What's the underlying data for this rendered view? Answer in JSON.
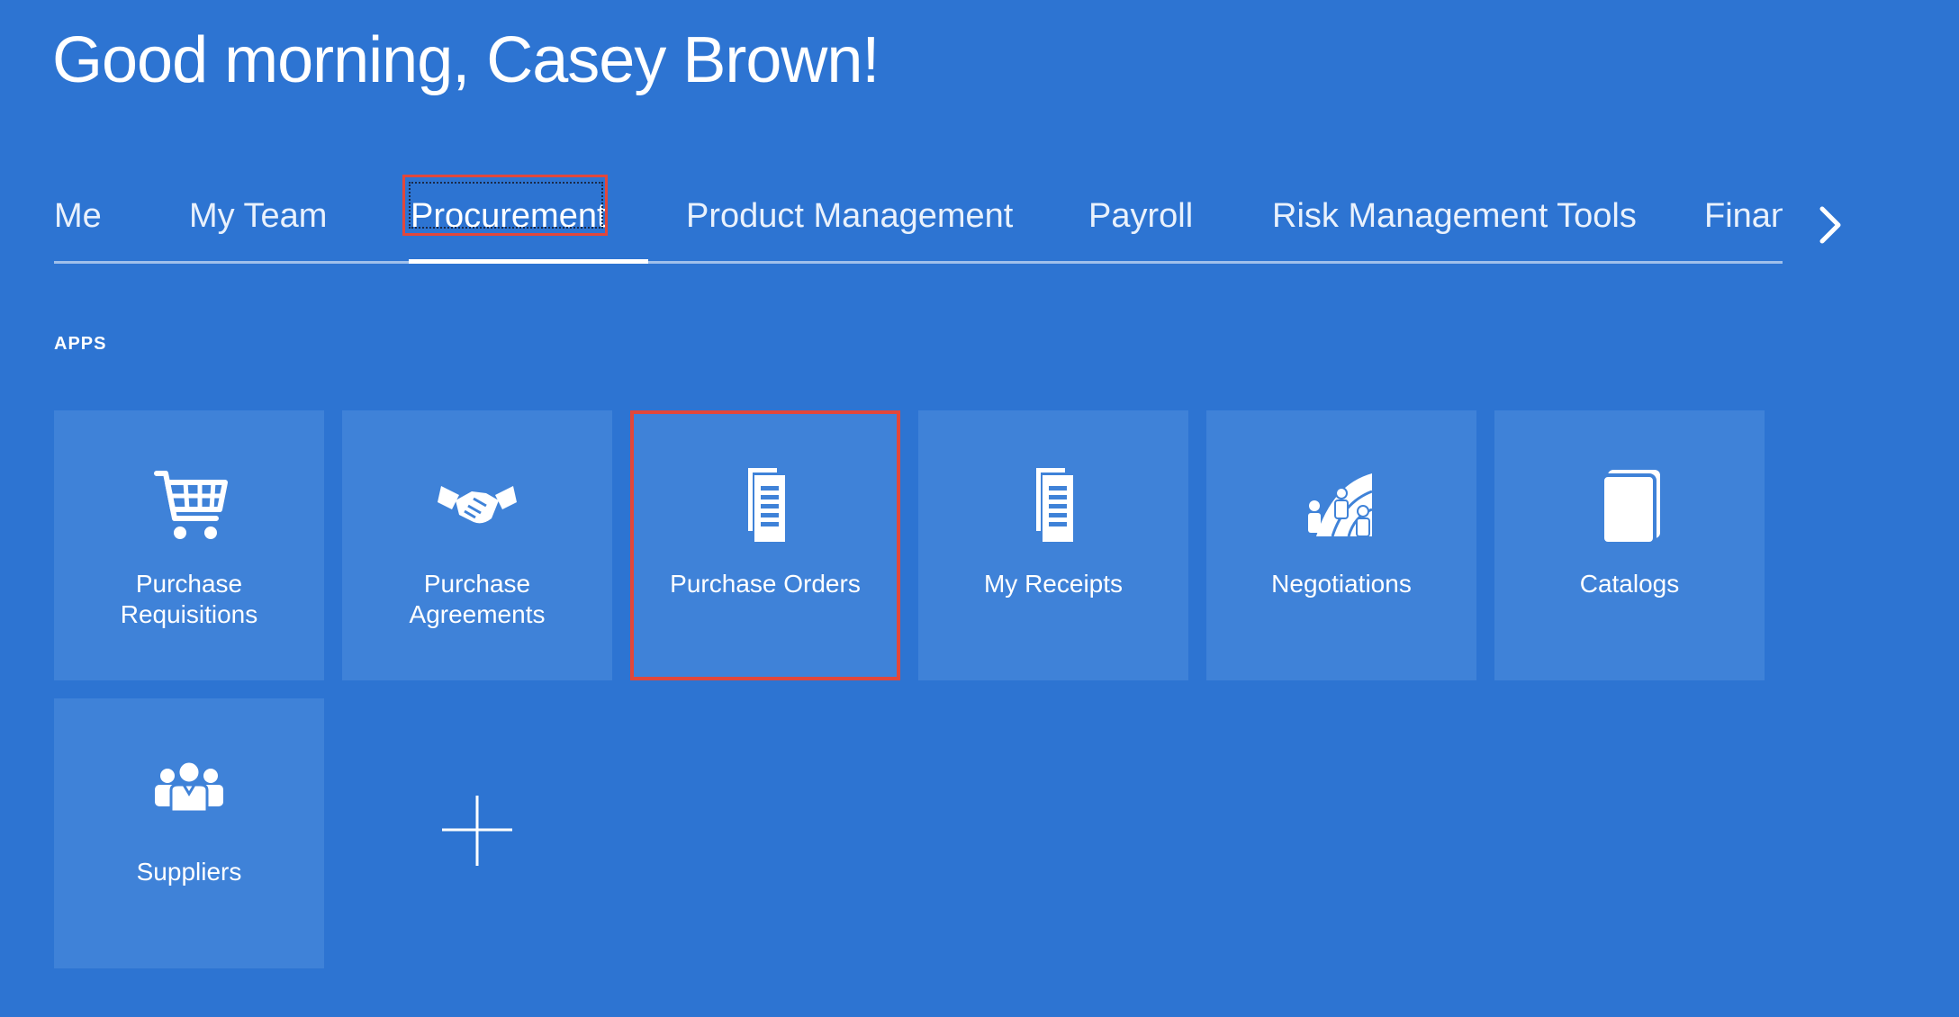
{
  "greeting": "Good morning, Casey Brown!",
  "tabs": [
    {
      "label": "Me"
    },
    {
      "label": "My Team"
    },
    {
      "label": "Procurement",
      "active": true
    },
    {
      "label": "Product Management"
    },
    {
      "label": "Payroll"
    },
    {
      "label": "Risk Management Tools"
    },
    {
      "label": "Finan"
    }
  ],
  "section": {
    "label": "APPS"
  },
  "apps": [
    {
      "label_line1": "Purchase",
      "label_line2": "Requisitions",
      "icon": "shopping-cart-icon"
    },
    {
      "label_line1": "Purchase",
      "label_line2": "Agreements",
      "icon": "handshake-icon"
    },
    {
      "label_line1": "Purchase Orders",
      "label_line2": "",
      "icon": "document-icon",
      "highlighted": true
    },
    {
      "label_line1": "My Receipts",
      "label_line2": "",
      "icon": "document-icon"
    },
    {
      "label_line1": "Negotiations",
      "label_line2": "",
      "icon": "negotiation-icon"
    },
    {
      "label_line1": "Catalogs",
      "label_line2": "",
      "icon": "catalog-icon"
    },
    {
      "label_line1": "Suppliers",
      "label_line2": "",
      "icon": "people-icon"
    }
  ],
  "colors": {
    "background": "#2d74d2",
    "tile": "#3f82d8",
    "highlight": "#e2473a",
    "text": "#ffffff"
  }
}
